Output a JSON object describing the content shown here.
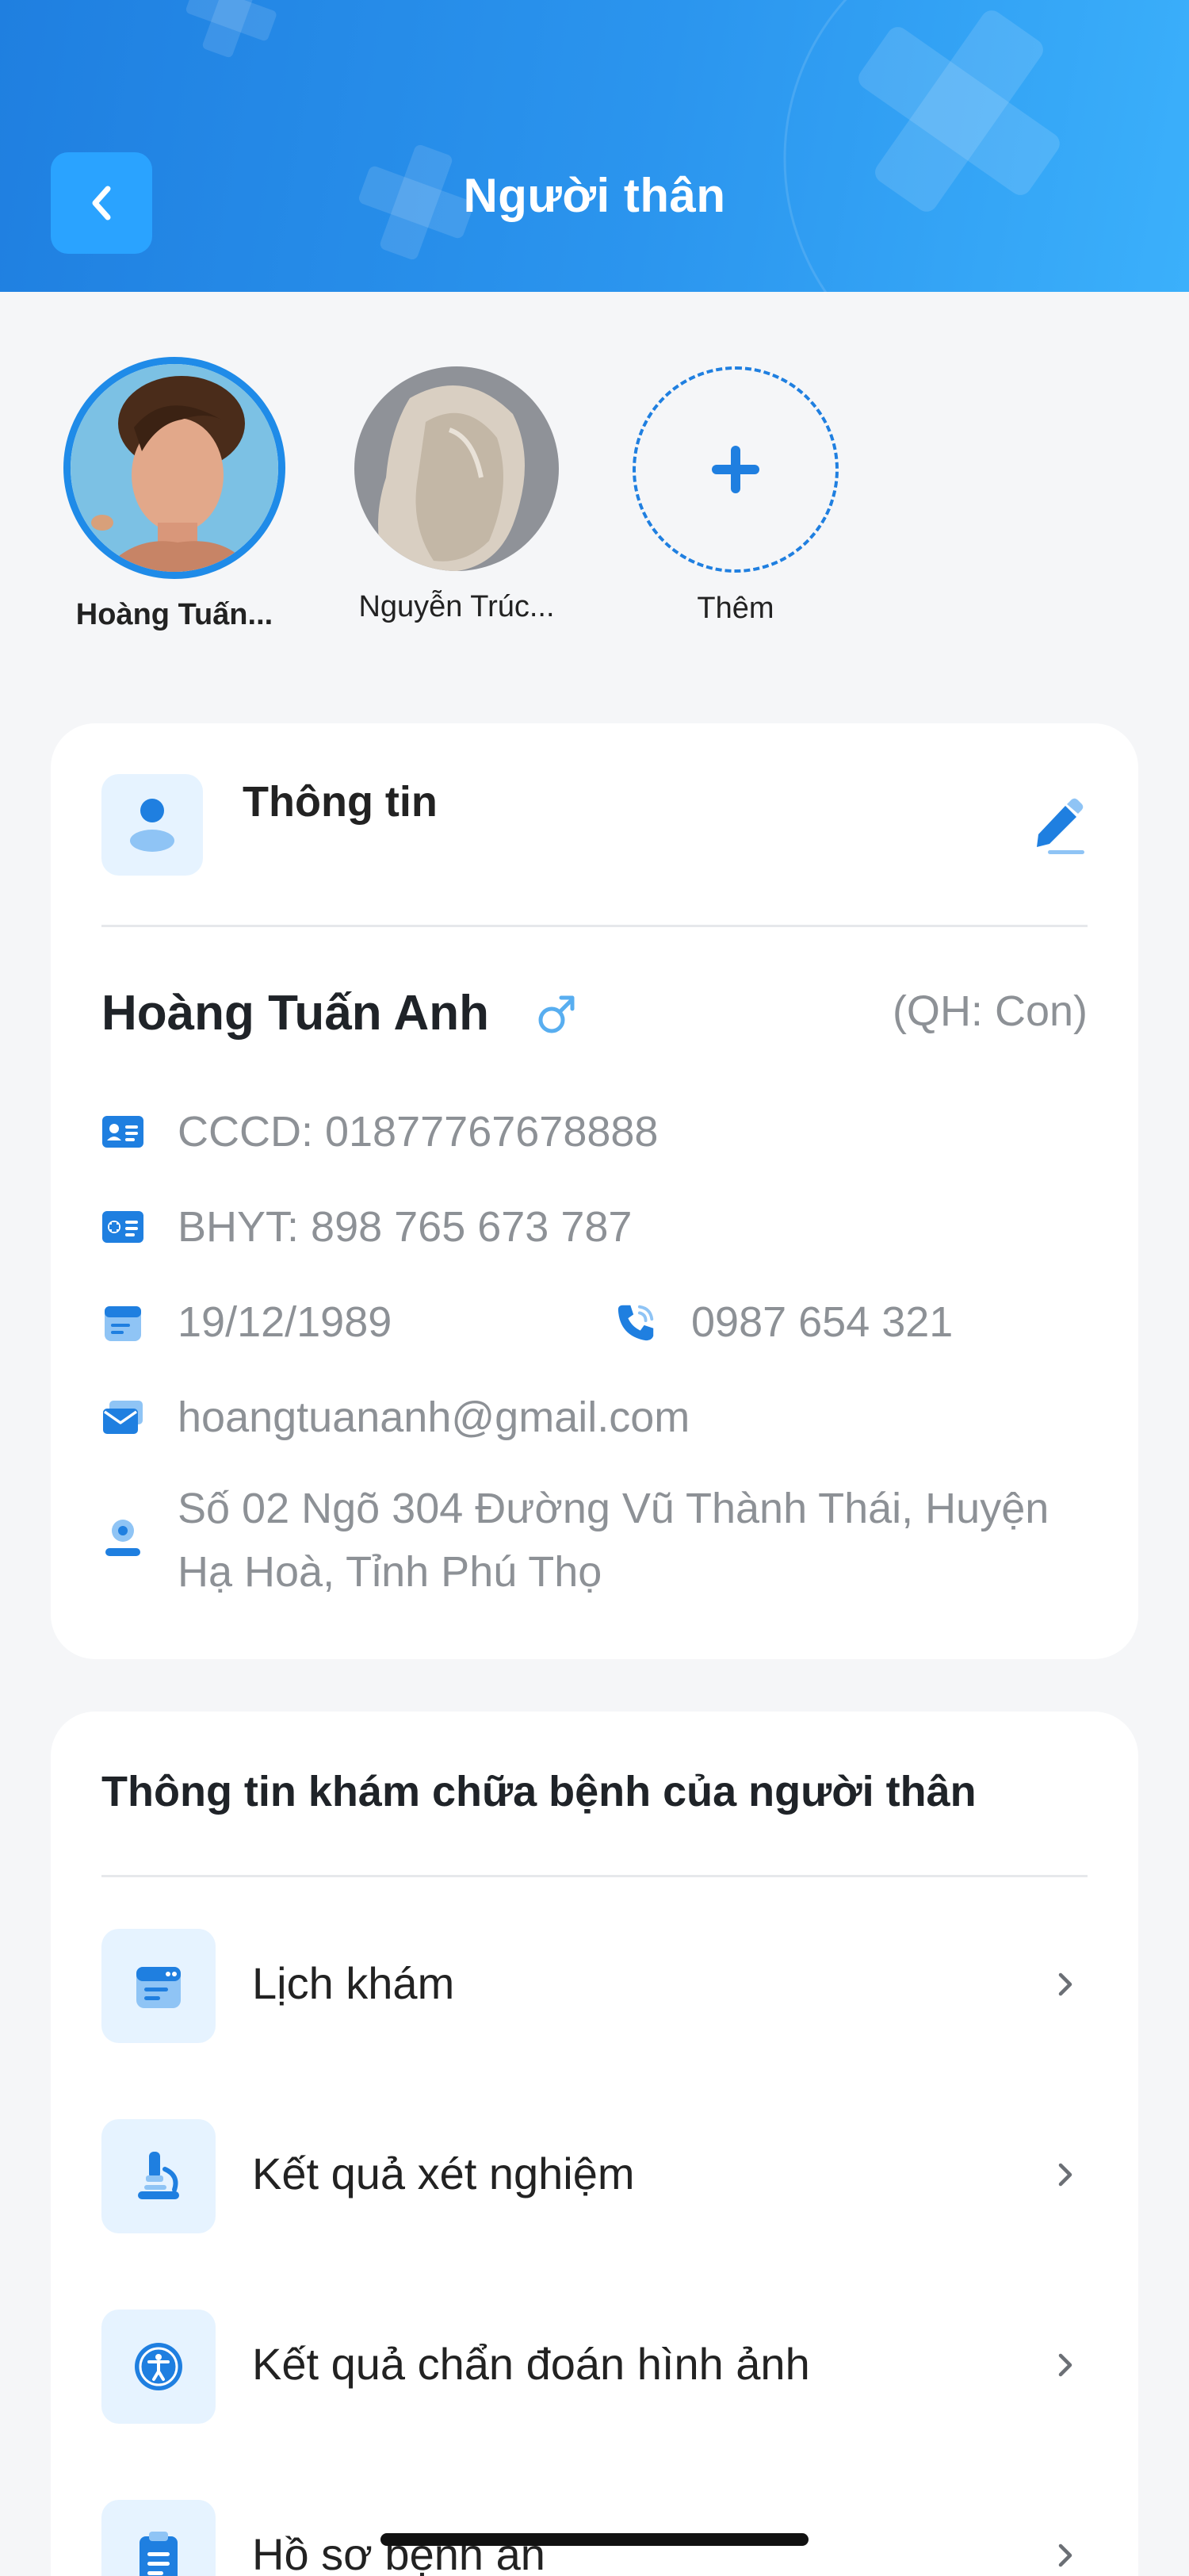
{
  "header": {
    "title": "Người thân",
    "back_icon": "chevron-left-icon"
  },
  "relatives": [
    {
      "name": "Hoàng Tuấn...",
      "active": true
    },
    {
      "name": "Nguyễn Trúc...",
      "active": false
    },
    {
      "name": "Thêm",
      "add": true
    }
  ],
  "info_card": {
    "section_title": "Thông tin",
    "full_name": "Hoàng Tuấn Anh",
    "relation": "(QH: Con)",
    "cccd": "CCCD: 01877767678888",
    "bhyt": "BHYT: 898 765 673 787",
    "dob": "19/12/1989",
    "phone": "0987 654 321",
    "email": "hoangtuananh@gmail.com",
    "address": "Số 02 Ngõ 304 Đường Vũ Thành Thái, Huyện Hạ Hoà, Tỉnh Phú Thọ"
  },
  "medical_card": {
    "title": "Thông tin khám chữa bệnh của người thân",
    "items": [
      {
        "label": "Lịch khám",
        "icon": "calendar-icon"
      },
      {
        "label": "Kết quả xét nghiệm",
        "icon": "microscope-icon"
      },
      {
        "label": "Kết quả chẩn đoán hình ảnh",
        "icon": "accessibility-icon"
      },
      {
        "label": "Hồ sơ bệnh án",
        "icon": "clipboard-icon"
      }
    ]
  },
  "colors": {
    "primary": "#1f7fe0",
    "accent_light": "#e6f3ff",
    "muted_text": "#8d9196"
  }
}
